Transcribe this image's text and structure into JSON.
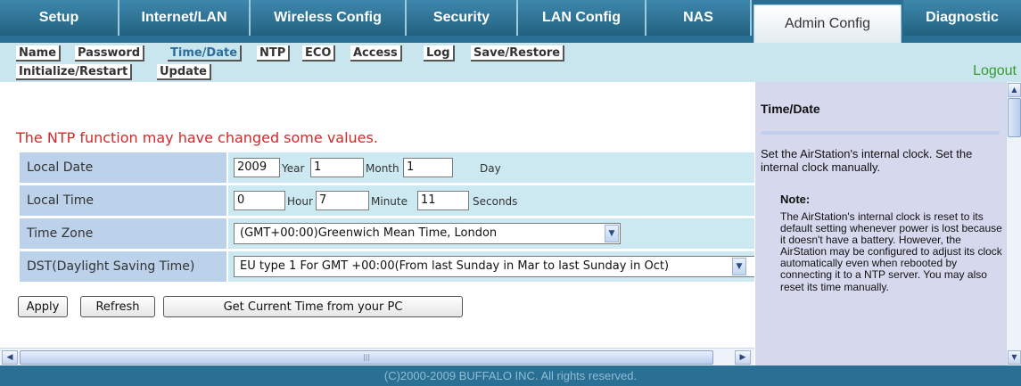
{
  "nav": {
    "tabs": [
      "Setup",
      "Internet/LAN",
      "Wireless Config",
      "Security",
      "LAN Config",
      "NAS",
      "Admin Config",
      "Diagnostic"
    ],
    "active_tab": "Admin Config"
  },
  "subnav": {
    "items": [
      "Name",
      "Password",
      "Time/Date",
      "NTP",
      "ECO",
      "Access",
      "Log",
      "Save/Restore",
      "Initialize/Restart",
      "Update"
    ],
    "active": "Time/Date",
    "logout": "Logout"
  },
  "notice": "The NTP function may have changed some values.",
  "form": {
    "local_date": {
      "label": "Local Date",
      "year": "2009",
      "year_unit": "Year",
      "month": "1",
      "month_unit": "Month",
      "day": "1",
      "day_unit": "Day"
    },
    "local_time": {
      "label": "Local Time",
      "hour": "0",
      "hour_unit": "Hour",
      "minute": "7",
      "minute_unit": "Minute",
      "seconds": "11",
      "seconds_unit": "Seconds"
    },
    "time_zone": {
      "label": "Time Zone",
      "value": "(GMT+00:00)Greenwich Mean Time, London"
    },
    "dst": {
      "label": "DST(Daylight Saving Time)",
      "value": "EU type 1 For GMT +00:00(From last Sunday in Mar to last Sunday in Oct)"
    }
  },
  "buttons": {
    "apply": "Apply",
    "refresh": "Refresh",
    "get_time": "Get Current Time from your PC"
  },
  "help": {
    "title": "Time/Date",
    "description": "Set the AirStation's internal clock. Set the internal clock manually.",
    "note_label": "Note:",
    "note_text": "The AirStation's internal clock is reset to its default setting whenever power is lost because it doesn't have a battery. However, the AirStation may be configured to adjust its clock automatically even when rebooted by connecting it to a NTP server. You may also reset its time manually."
  },
  "footer": "(C)2000-2009 BUFFALO INC. All rights reserved.",
  "icons": {
    "up": "arrow-up-icon",
    "down": "arrow-down-icon",
    "left": "arrow-left-icon",
    "right": "arrow-right-icon",
    "dropdown": "chevron-down-icon"
  },
  "colors": {
    "nav_bg": "#2a6f94",
    "subnav_bg": "#c9e6ef",
    "notice": "#d42828",
    "label_bg": "#bcd1ea",
    "field_bg": "#cce9f1",
    "help_bg": "#d6d9ee",
    "logout": "#3a9a2f"
  }
}
